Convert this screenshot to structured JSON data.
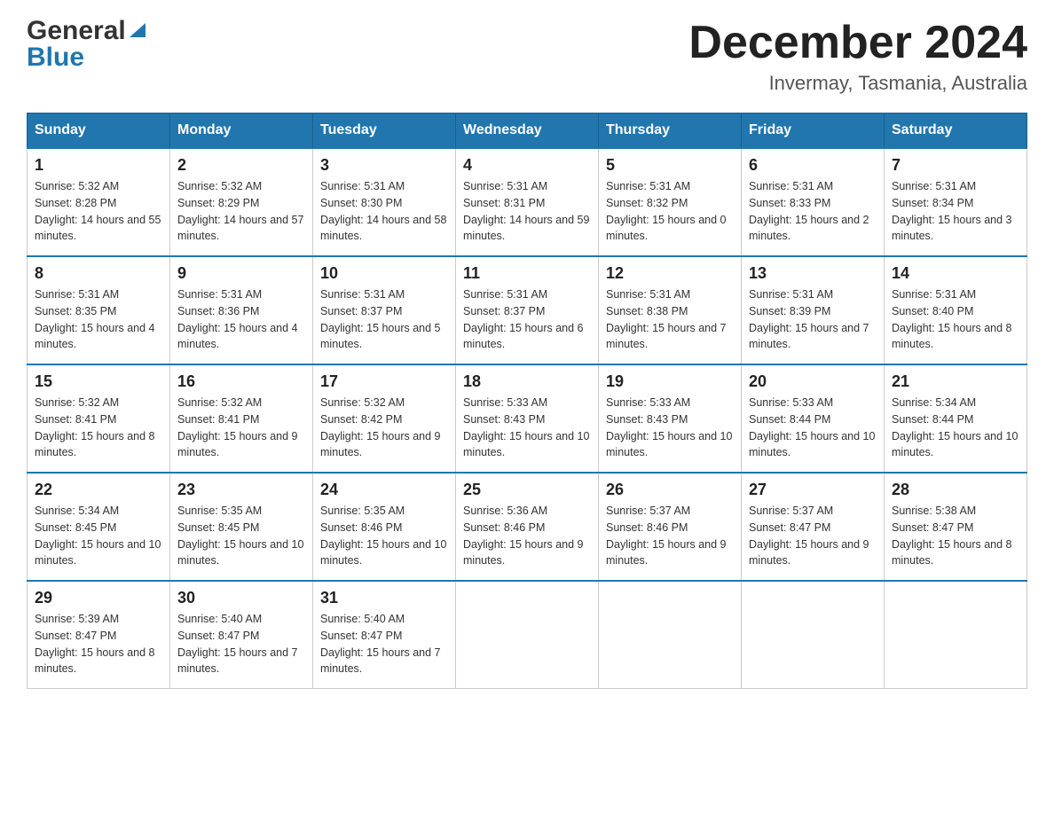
{
  "header": {
    "logo_general": "General",
    "logo_blue": "Blue",
    "month_title": "December 2024",
    "location": "Invermay, Tasmania, Australia"
  },
  "calendar": {
    "days_of_week": [
      "Sunday",
      "Monday",
      "Tuesday",
      "Wednesday",
      "Thursday",
      "Friday",
      "Saturday"
    ],
    "weeks": [
      [
        {
          "day": "1",
          "sunrise": "5:32 AM",
          "sunset": "8:28 PM",
          "daylight": "14 hours and 55 minutes."
        },
        {
          "day": "2",
          "sunrise": "5:32 AM",
          "sunset": "8:29 PM",
          "daylight": "14 hours and 57 minutes."
        },
        {
          "day": "3",
          "sunrise": "5:31 AM",
          "sunset": "8:30 PM",
          "daylight": "14 hours and 58 minutes."
        },
        {
          "day": "4",
          "sunrise": "5:31 AM",
          "sunset": "8:31 PM",
          "daylight": "14 hours and 59 minutes."
        },
        {
          "day": "5",
          "sunrise": "5:31 AM",
          "sunset": "8:32 PM",
          "daylight": "15 hours and 0 minutes."
        },
        {
          "day": "6",
          "sunrise": "5:31 AM",
          "sunset": "8:33 PM",
          "daylight": "15 hours and 2 minutes."
        },
        {
          "day": "7",
          "sunrise": "5:31 AM",
          "sunset": "8:34 PM",
          "daylight": "15 hours and 3 minutes."
        }
      ],
      [
        {
          "day": "8",
          "sunrise": "5:31 AM",
          "sunset": "8:35 PM",
          "daylight": "15 hours and 4 minutes."
        },
        {
          "day": "9",
          "sunrise": "5:31 AM",
          "sunset": "8:36 PM",
          "daylight": "15 hours and 4 minutes."
        },
        {
          "day": "10",
          "sunrise": "5:31 AM",
          "sunset": "8:37 PM",
          "daylight": "15 hours and 5 minutes."
        },
        {
          "day": "11",
          "sunrise": "5:31 AM",
          "sunset": "8:37 PM",
          "daylight": "15 hours and 6 minutes."
        },
        {
          "day": "12",
          "sunrise": "5:31 AM",
          "sunset": "8:38 PM",
          "daylight": "15 hours and 7 minutes."
        },
        {
          "day": "13",
          "sunrise": "5:31 AM",
          "sunset": "8:39 PM",
          "daylight": "15 hours and 7 minutes."
        },
        {
          "day": "14",
          "sunrise": "5:31 AM",
          "sunset": "8:40 PM",
          "daylight": "15 hours and 8 minutes."
        }
      ],
      [
        {
          "day": "15",
          "sunrise": "5:32 AM",
          "sunset": "8:41 PM",
          "daylight": "15 hours and 8 minutes."
        },
        {
          "day": "16",
          "sunrise": "5:32 AM",
          "sunset": "8:41 PM",
          "daylight": "15 hours and 9 minutes."
        },
        {
          "day": "17",
          "sunrise": "5:32 AM",
          "sunset": "8:42 PM",
          "daylight": "15 hours and 9 minutes."
        },
        {
          "day": "18",
          "sunrise": "5:33 AM",
          "sunset": "8:43 PM",
          "daylight": "15 hours and 10 minutes."
        },
        {
          "day": "19",
          "sunrise": "5:33 AM",
          "sunset": "8:43 PM",
          "daylight": "15 hours and 10 minutes."
        },
        {
          "day": "20",
          "sunrise": "5:33 AM",
          "sunset": "8:44 PM",
          "daylight": "15 hours and 10 minutes."
        },
        {
          "day": "21",
          "sunrise": "5:34 AM",
          "sunset": "8:44 PM",
          "daylight": "15 hours and 10 minutes."
        }
      ],
      [
        {
          "day": "22",
          "sunrise": "5:34 AM",
          "sunset": "8:45 PM",
          "daylight": "15 hours and 10 minutes."
        },
        {
          "day": "23",
          "sunrise": "5:35 AM",
          "sunset": "8:45 PM",
          "daylight": "15 hours and 10 minutes."
        },
        {
          "day": "24",
          "sunrise": "5:35 AM",
          "sunset": "8:46 PM",
          "daylight": "15 hours and 10 minutes."
        },
        {
          "day": "25",
          "sunrise": "5:36 AM",
          "sunset": "8:46 PM",
          "daylight": "15 hours and 9 minutes."
        },
        {
          "day": "26",
          "sunrise": "5:37 AM",
          "sunset": "8:46 PM",
          "daylight": "15 hours and 9 minutes."
        },
        {
          "day": "27",
          "sunrise": "5:37 AM",
          "sunset": "8:47 PM",
          "daylight": "15 hours and 9 minutes."
        },
        {
          "day": "28",
          "sunrise": "5:38 AM",
          "sunset": "8:47 PM",
          "daylight": "15 hours and 8 minutes."
        }
      ],
      [
        {
          "day": "29",
          "sunrise": "5:39 AM",
          "sunset": "8:47 PM",
          "daylight": "15 hours and 8 minutes."
        },
        {
          "day": "30",
          "sunrise": "5:40 AM",
          "sunset": "8:47 PM",
          "daylight": "15 hours and 7 minutes."
        },
        {
          "day": "31",
          "sunrise": "5:40 AM",
          "sunset": "8:47 PM",
          "daylight": "15 hours and 7 minutes."
        },
        null,
        null,
        null,
        null
      ]
    ],
    "labels": {
      "sunrise": "Sunrise:",
      "sunset": "Sunset:",
      "daylight": "Daylight:"
    }
  }
}
